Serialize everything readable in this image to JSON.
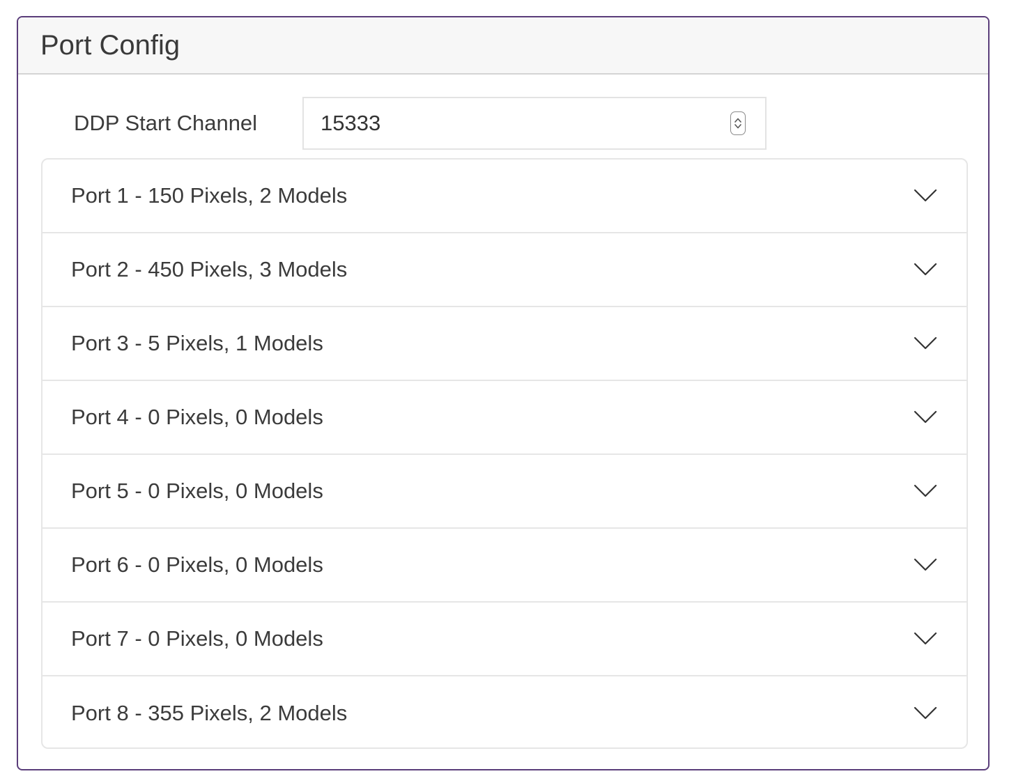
{
  "card": {
    "title": "Port Config"
  },
  "ddp": {
    "label": "DDP Start Channel",
    "value": "15333"
  },
  "ports": [
    {
      "label": "Port 1 - 150 Pixels, 2 Models"
    },
    {
      "label": "Port 2 - 450 Pixels, 3 Models"
    },
    {
      "label": "Port 3 - 5 Pixels, 1 Models"
    },
    {
      "label": "Port 4 - 0 Pixels, 0 Models"
    },
    {
      "label": "Port 5 - 0 Pixels, 0 Models"
    },
    {
      "label": "Port 6 - 0 Pixels, 0 Models"
    },
    {
      "label": "Port 7 - 0 Pixels, 0 Models"
    },
    {
      "label": "Port 8 - 355 Pixels, 2 Models"
    }
  ],
  "icons": {
    "expand": "chevron-down-icon",
    "spinner": "stepper-arrows-icon"
  },
  "colors": {
    "card_border": "#5a3d7a",
    "header_background": "#f7f7f7",
    "text": "#3b3b3b"
  }
}
